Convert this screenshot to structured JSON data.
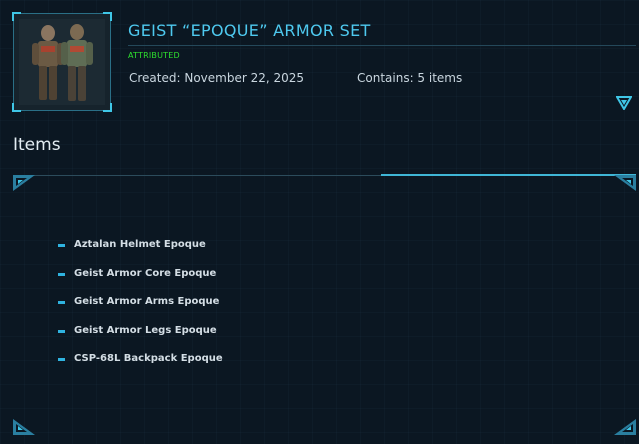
{
  "header": {
    "title": "GEIST “EPOQUE” ARMOR SET",
    "status_badge": "ATTRIBUTED",
    "created": "Created: November 22, 2025",
    "contains": "Contains: 5 items",
    "thumbnail_icon": "armor-set-image",
    "expand_icon": "chevron-down-icon"
  },
  "items_section": {
    "title": "Items",
    "items": [
      "Aztalan Helmet Epoque",
      "Geist Armor Core Epoque",
      "Geist Armor Arms Epoque",
      "Geist Armor Legs Epoque",
      "CSP-68L Backpack Epoque"
    ]
  },
  "colors": {
    "background": "#0b1722",
    "accent": "#4ec9ef",
    "badge": "#2ee02e",
    "bullet": "#2fb3e0"
  }
}
